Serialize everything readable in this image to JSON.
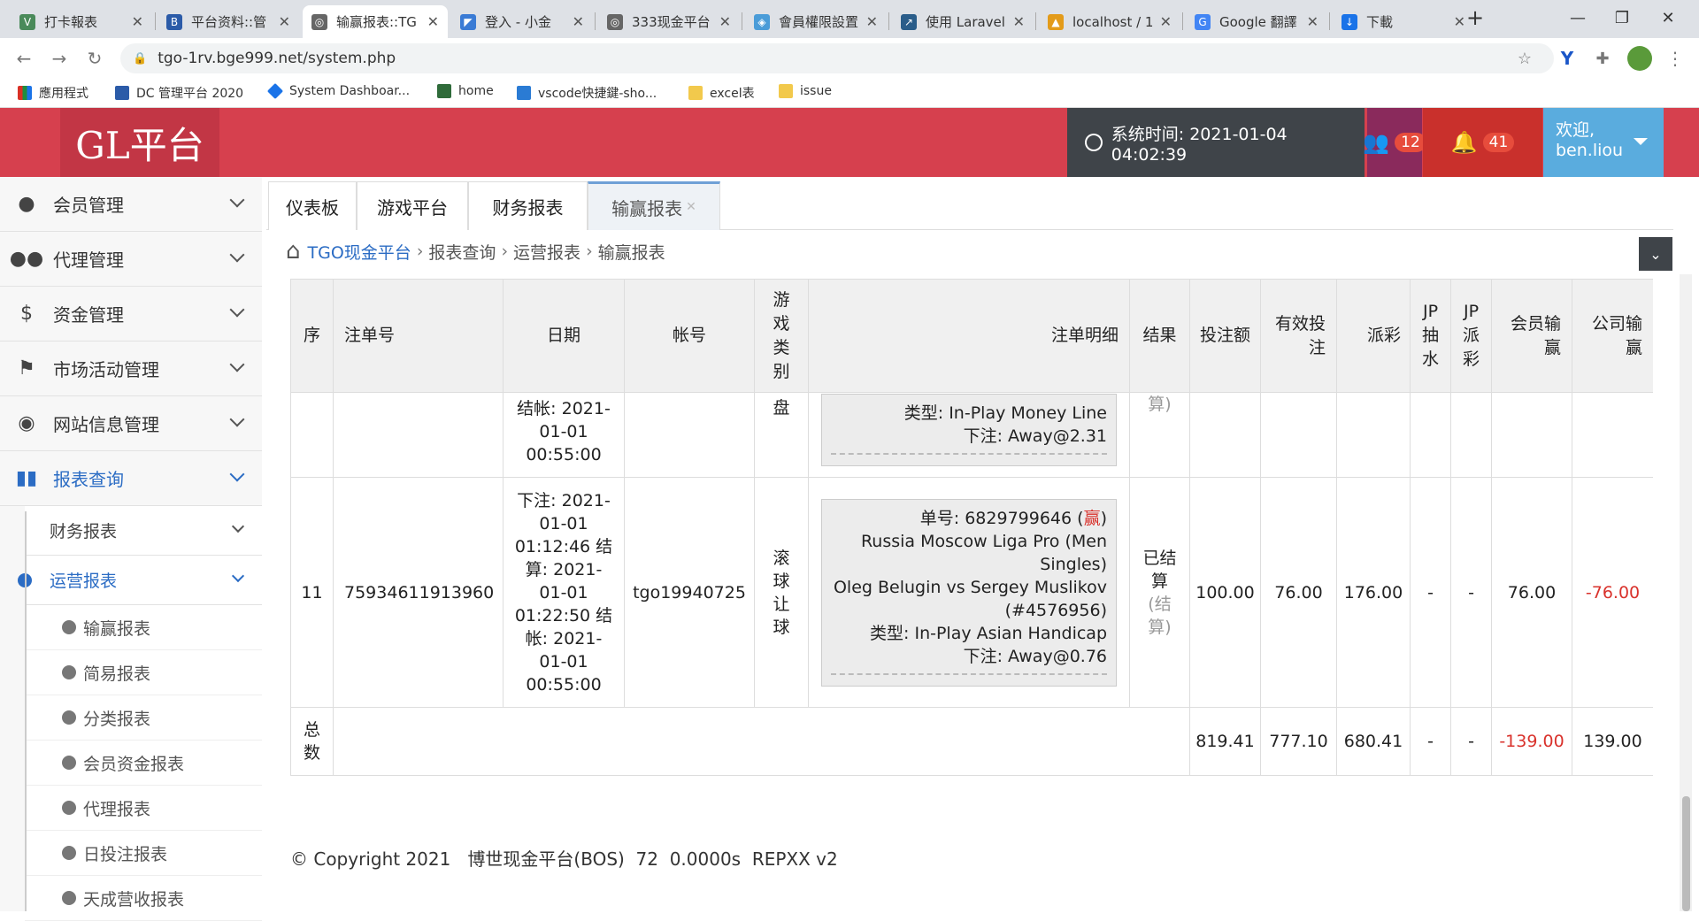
{
  "browser": {
    "tabs": [
      {
        "label": "打卡報表",
        "color": "#4a8a5a"
      },
      {
        "label": "平台资料::管",
        "color": "#2b5ba8"
      },
      {
        "label": "输赢报表::TG",
        "color": "#666666"
      },
      {
        "label": "登入 - 小金",
        "color": "#3a7bd5"
      },
      {
        "label": "333现金平台",
        "color": "#666666"
      },
      {
        "label": "會員權限設置",
        "color": "#4a9cd8"
      },
      {
        "label": "使用 Laravel",
        "color": "#2a5d8a"
      },
      {
        "label": "localhost / 1",
        "color": "#e39b1a"
      },
      {
        "label": "Google 翻譯",
        "color": "#4285f4"
      },
      {
        "label": "下載",
        "color": "#1a73e8"
      }
    ],
    "url": "tgo-1rv.bge999.net/system.php",
    "bookmarks": [
      {
        "label": "應用程式",
        "color": "#d93025"
      },
      {
        "label": "DC 管理平台 2020",
        "color": "#2b5ba8"
      },
      {
        "label": "System Dashboar...",
        "color": "#1a73e8"
      },
      {
        "label": "home",
        "color": "#2f6b3a"
      },
      {
        "label": "vscode快捷鍵-sho...",
        "color": "#2a7bd4"
      },
      {
        "label": "excel表",
        "color": "#f2c94c"
      },
      {
        "label": "issue",
        "color": "#f2c94c"
      }
    ]
  },
  "header": {
    "logo": "GL平台",
    "system_time": "系统时间: 2021-01-04 04:02:39",
    "users_count": "12",
    "notifications_count": "41",
    "welcome_line1": "欢迎,",
    "welcome_line2": "ben.liou"
  },
  "sidebar": {
    "items": [
      {
        "label": "会员管理",
        "icon": "user-icon"
      },
      {
        "label": "代理管理",
        "icon": "users-icon"
      },
      {
        "label": "资金管理",
        "icon": "dollar-icon"
      },
      {
        "label": "市场活动管理",
        "icon": "flag-icon"
      },
      {
        "label": "网站信息管理",
        "icon": "eye-icon"
      },
      {
        "label": "报表查询",
        "icon": "bar-chart-icon"
      }
    ],
    "sub_items": [
      {
        "label": "财务报表"
      },
      {
        "label": "运营报表"
      }
    ],
    "report_items": [
      {
        "label": "输赢报表"
      },
      {
        "label": "简易报表"
      },
      {
        "label": "分类报表"
      },
      {
        "label": "会员资金报表"
      },
      {
        "label": "代理报表"
      },
      {
        "label": "日投注报表"
      },
      {
        "label": "天成营收报表"
      }
    ]
  },
  "main_tabs": [
    {
      "label": "仪表板"
    },
    {
      "label": "游戏平台"
    },
    {
      "label": "财务报表"
    },
    {
      "label": "输赢报表"
    }
  ],
  "breadcrumb": {
    "home": "TGO现金平台",
    "level1": "报表查询",
    "level2": "运营报表",
    "level3": "输赢报表"
  },
  "table": {
    "headers": {
      "seq": "序",
      "bet_no": "注单号",
      "date": "日期",
      "account": "帐号",
      "game_type": "游戏类别",
      "detail": "注单明细",
      "result": "结果",
      "bet_amount": "投注额",
      "valid_bet": "有效投注",
      "payout": "派彩",
      "jp_rake": "JP抽水",
      "jp_payout": "JP派彩",
      "member_win": "会员输赢",
      "company_win": "公司输赢"
    },
    "partial_row": {
      "date_tail": "结帐: 2021-01-01 00:55:00",
      "game_tail": "盘",
      "detail_type": "类型: In-Play Money Line",
      "detail_bet": "下注: Away@2.31",
      "result_tail": "算)"
    },
    "row": {
      "seq": "11",
      "bet_no": "75934611913960",
      "date": "下注: 2021-01-01 01:12:46 结算: 2021-01-01 01:22:50 结帐: 2021-01-01 00:55:00",
      "account": "tgo19940725",
      "game_type": "滚球让球",
      "detail_ticket": "单号: 6829799646 (",
      "detail_ticket_flag": "赢",
      "detail_ticket_end": ")",
      "detail_league": "Russia Moscow Liga Pro (Men Singles)",
      "detail_match": "Oleg Belugin vs Sergey Muslikov (#4576956)",
      "detail_type": "类型: In-Play Asian Handicap",
      "detail_bet": "下注: Away@0.76",
      "result": "已结算",
      "result_sub": "(结算)",
      "bet_amount": "100.00",
      "valid_bet": "76.00",
      "payout": "176.00",
      "jp_rake": "-",
      "jp_payout": "-",
      "member_win": "76.00",
      "company_win": "-76.00"
    },
    "total": {
      "label": "总数",
      "bet_amount": "819.41",
      "valid_bet": "777.10",
      "payout": "680.41",
      "jp_rake": "-",
      "jp_payout": "-",
      "member_win": "-139.00",
      "company_win": "139.00"
    }
  },
  "footer": {
    "copyright": "© Copyright 2021   博世现金平台(BOS)  72  0.0000s  REPXX v2"
  },
  "colors": {
    "header_red": "#d6404e",
    "accent_blue": "#2b6cc4",
    "negative_red": "#d9322c"
  }
}
